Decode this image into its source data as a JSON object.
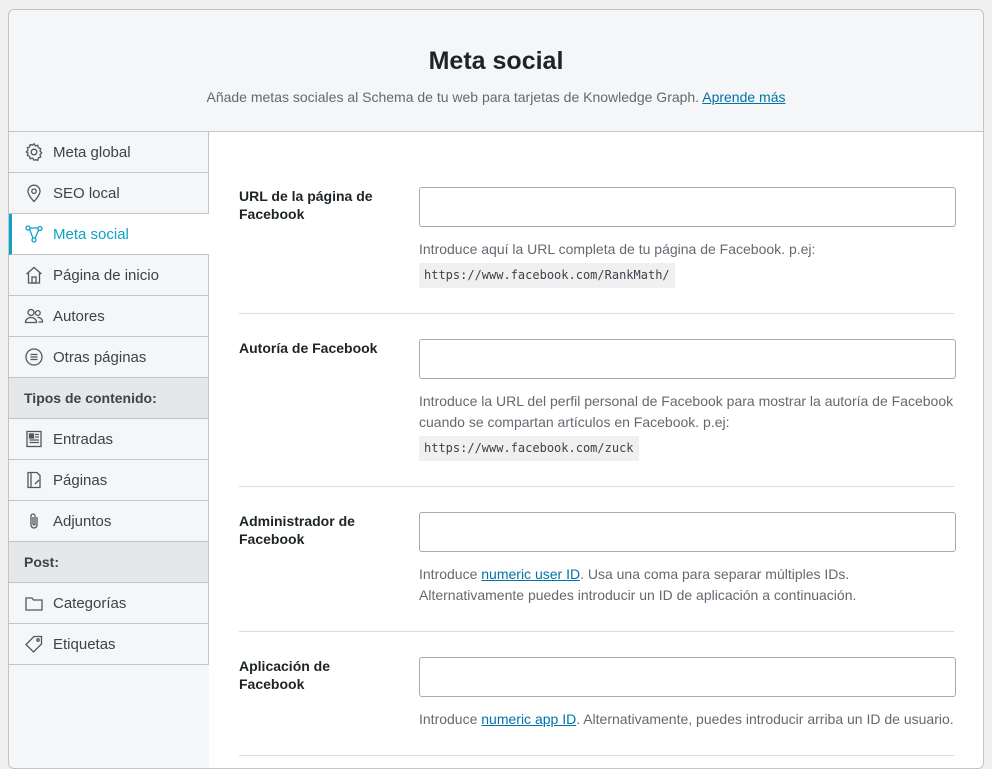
{
  "header": {
    "title": "Meta social",
    "description": "Añade metas sociales al Schema de tu web para tarjetas de Knowledge Graph.",
    "learn_more": "Aprende más"
  },
  "sidebar": {
    "items": [
      {
        "label": "Meta global",
        "icon": "gear-icon"
      },
      {
        "label": "SEO local",
        "icon": "map-pin-icon"
      },
      {
        "label": "Meta social",
        "icon": "share-network-icon",
        "active": true
      },
      {
        "label": "Página de inicio",
        "icon": "home-icon"
      },
      {
        "label": "Autores",
        "icon": "users-icon"
      },
      {
        "label": "Otras páginas",
        "icon": "list-circle-icon"
      }
    ],
    "section_content": "Tipos de contenido:",
    "content_items": [
      {
        "label": "Entradas",
        "icon": "post-icon"
      },
      {
        "label": "Páginas",
        "icon": "page-icon"
      },
      {
        "label": "Adjuntos",
        "icon": "paperclip-icon"
      }
    ],
    "section_post": "Post:",
    "post_items": [
      {
        "label": "Categorías",
        "icon": "folder-icon"
      },
      {
        "label": "Etiquetas",
        "icon": "tag-icon"
      }
    ]
  },
  "form": {
    "facebook_page": {
      "label": "URL de la página de Facebook",
      "value": "",
      "help": "Introduce aquí la URL completa de tu página de Facebook. p.ej:",
      "example": "https://www.facebook.com/RankMath/"
    },
    "facebook_authorship": {
      "label": "Autoría de Facebook",
      "value": "",
      "help": "Introduce la URL del perfil personal de Facebook para mostrar la autoría de Facebook cuando se compartan artículos en Facebook. p.ej:",
      "example": "https://www.facebook.com/zuck"
    },
    "facebook_admin": {
      "label": "Administrador de Facebook",
      "value": "",
      "help_prefix": "Introduce",
      "help_link": "numeric user ID",
      "help_suffix": ". Usa una coma para separar múltiples IDs. Alternativamente puedes introducir un ID de aplicación a continuación."
    },
    "facebook_app": {
      "label": "Aplicación de Facebook",
      "value": "",
      "help_prefix": "Introduce",
      "help_link": "numeric app ID",
      "help_suffix": ". Alternativamente, puedes introducir arriba un ID de usuario."
    }
  },
  "colors": {
    "accent": "#0ea2c7",
    "link": "#0073aa"
  }
}
